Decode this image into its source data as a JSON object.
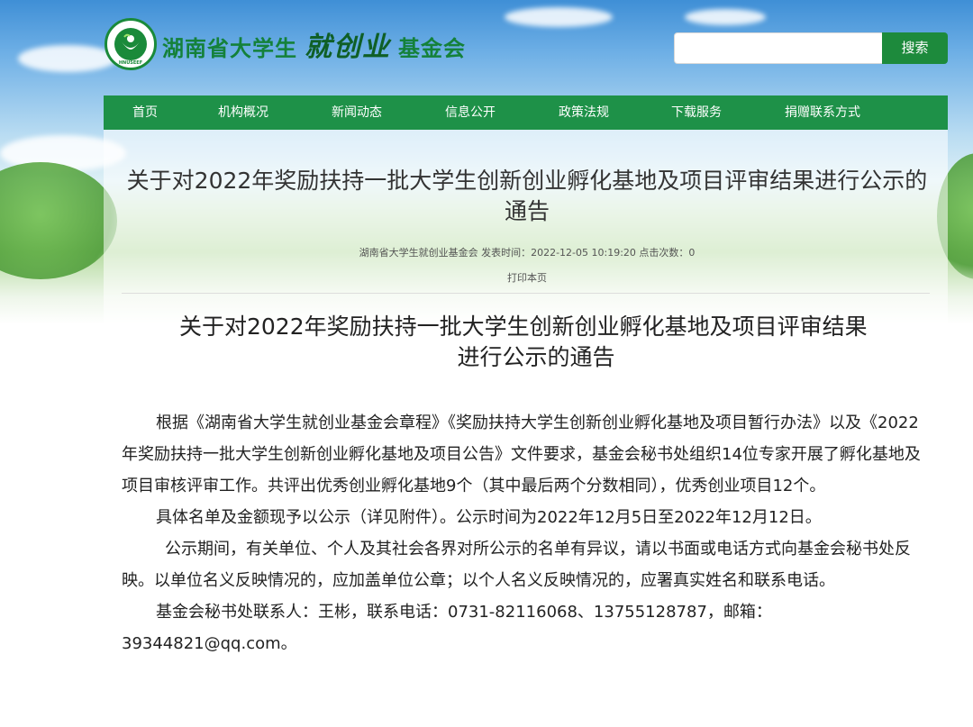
{
  "header": {
    "logo_text": "HNUSEEF",
    "logo_ring_text": "湖南省大学生就创业基金会",
    "title_part1": "湖南省大学生",
    "title_script": "就创业",
    "title_part2": "基金会"
  },
  "search": {
    "placeholder": "",
    "button_label": "搜索"
  },
  "nav": {
    "items": [
      "首页",
      "机构概况",
      "新闻动态",
      "信息公开",
      "政策法规",
      "下载服务",
      "捐赠联系方式"
    ]
  },
  "article": {
    "title": "关于对2022年奖励扶持一批大学生创新创业孵化基地及项目评审结果进行公示的通告",
    "meta": "湖南省大学生就创业基金会 发表时间：2022-12-05 10:19:20 点击次数：0",
    "print_label": "打印本页",
    "inner_title_line1": "关于对2022年奖励扶持一批大学生创新创业孵化基地及项目评审结果",
    "inner_title_line2": "进行公示的通告",
    "paragraphs": [
      "根据《湖南省大学生就创业基金会章程》《奖励扶持大学生创新创业孵化基地及项目暂行办法》以及《2022年奖励扶持一批大学生创新创业孵化基地及项目公告》文件要求，基金会秘书处组织14位专家开展了孵化基地及项目审核评审工作。共评出优秀创业孵化基地9个（其中最后两个分数相同），优秀创业项目12个。",
      "具体名单及金额现予以公示（详见附件）。公示时间为2022年12月5日至2022年12月12日。",
      "公示期间，有关单位、个人及其社会各界对所公示的名单有异议，请以书面或电话方式向基金会秘书处反映。以单位名义反映情况的，应加盖单位公章；以个人名义反映情况的，应署真实姓名和联系电话。",
      "基金会秘书处联系人：王彬，联系电话：0731-82116068、13755128787，邮箱：39344821@qq.com。"
    ]
  },
  "colors": {
    "brand_green": "#1e9148",
    "search_button": "#1d8a3c"
  }
}
